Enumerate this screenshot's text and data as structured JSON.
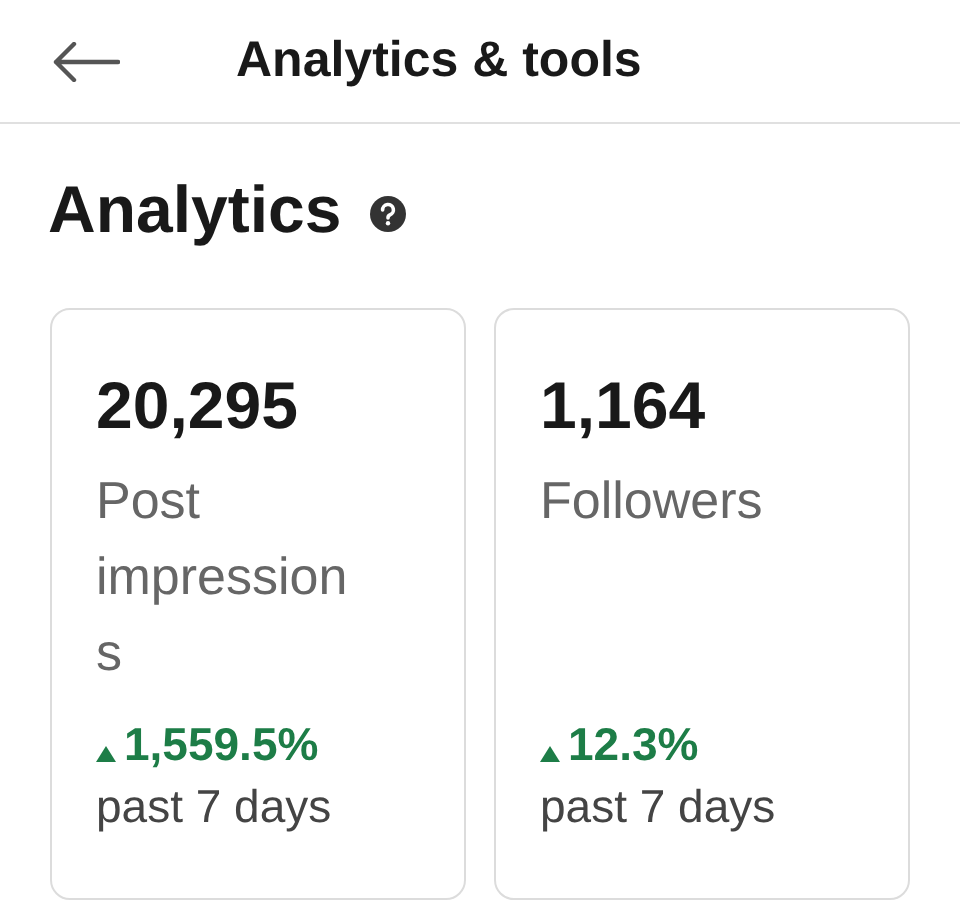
{
  "header": {
    "title": "Analytics & tools"
  },
  "section": {
    "title": "Analytics"
  },
  "cards": [
    {
      "value": "20,295",
      "label": "Post impressions",
      "increase": true,
      "change": "1,559.5%",
      "period": "past 7 days"
    },
    {
      "value": "1,164",
      "label": "Followers",
      "increase": true,
      "change": "12.3%",
      "period": "past 7 days"
    }
  ]
}
